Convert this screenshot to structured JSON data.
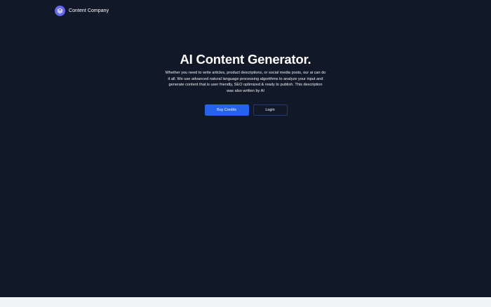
{
  "header": {
    "brand_name": "Content Company",
    "logo_icon": "layers-icon",
    "accent_color": "#6366f1"
  },
  "hero": {
    "title": "AI Content Generator.",
    "description": "Whether you need to write articles, product descriptions, or social media posts, our ai can do it all. We use advanced natural language processing algorithms to analyze your input and generate content that is user friendly, SEO optimized & ready to publish. This description was also written by AI"
  },
  "actions": {
    "buy_credits_label": "Buy Credits",
    "login_label": "Login",
    "primary_color": "#2563eb"
  },
  "theme": {
    "background": "#111827"
  }
}
